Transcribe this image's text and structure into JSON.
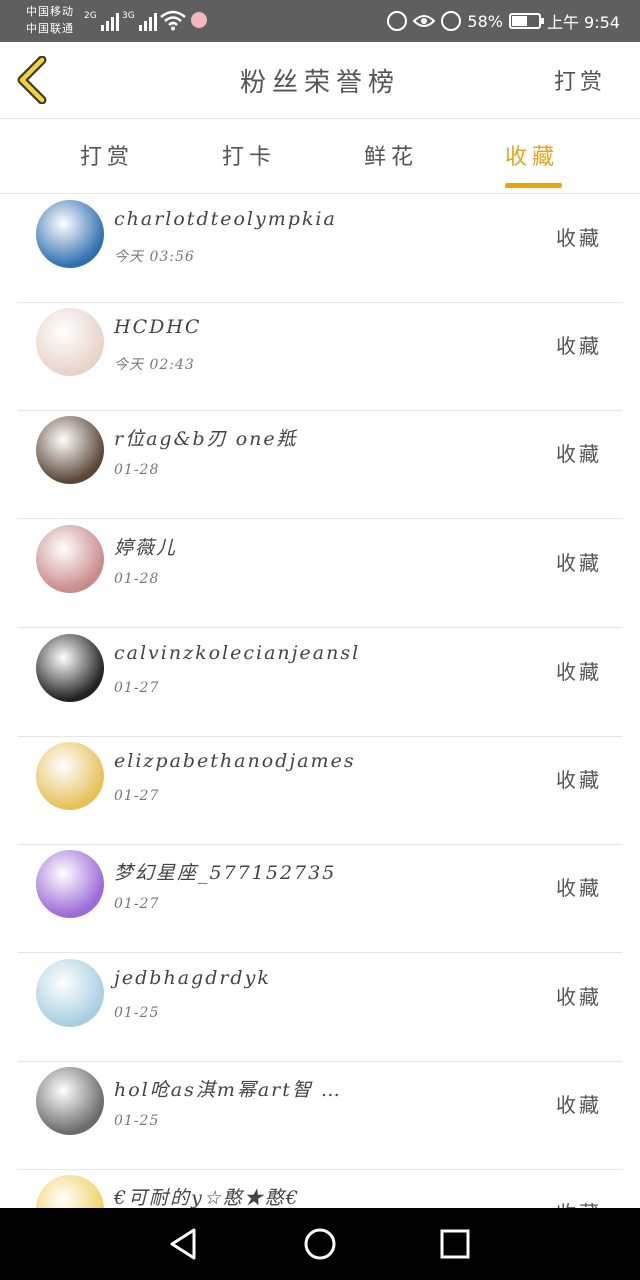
{
  "status_bar": {
    "carrier_1": "中国移动",
    "carrier_2": "中国联通",
    "net_1": "2G",
    "net_2": "3G",
    "battery": "58%",
    "time": "上午 9:54"
  },
  "header": {
    "title": "粉丝荣誉榜",
    "right_action": "打赏"
  },
  "tabs": [
    {
      "label": "打赏"
    },
    {
      "label": "打卡"
    },
    {
      "label": "鲜花"
    },
    {
      "label": "收藏",
      "active": true
    }
  ],
  "fans": [
    {
      "name": "charlotdteolympkia",
      "time": "今天 03:56",
      "action": "收藏",
      "avatar_color": "#2f6fb0"
    },
    {
      "name": "HCDHC",
      "time": "今天 02:43",
      "action": "收藏",
      "avatar_color": "#e8d3c8"
    },
    {
      "name": "r位ag&b刃 one羝",
      "time": "01-28",
      "action": "收藏",
      "avatar_color": "#5a4636"
    },
    {
      "name": "婷薇儿",
      "time": "01-28",
      "action": "收藏",
      "avatar_color": "#c98a8a"
    },
    {
      "name": "calvinzkolecianjeansl",
      "time": "01-27",
      "action": "收藏",
      "avatar_color": "#222222"
    },
    {
      "name": "elizpabethanodjames",
      "time": "01-27",
      "action": "收藏",
      "avatar_color": "#e6c15a"
    },
    {
      "name": "梦幻星座_577152735",
      "time": "01-27",
      "action": "收藏",
      "avatar_color": "#9a6ad6"
    },
    {
      "name": "jedbhagdrdyk",
      "time": "01-25",
      "action": "收藏",
      "avatar_color": "#a8cfe0"
    },
    {
      "name": "hol呛as淇m幂art智 …",
      "time": "01-25",
      "action": "收藏",
      "avatar_color": "#6b6b6b"
    },
    {
      "name": "€可耐的y☆憨★憨€",
      "time": "",
      "action": "收藏",
      "avatar_color": "#f0d060"
    }
  ],
  "colors": {
    "accent": "#e8a21f",
    "status_bar": "#5f5f5f",
    "nav_bar": "#000000"
  },
  "icons": {
    "back": "chevron-left-icon",
    "nav_back": "triangle-back-icon",
    "nav_home": "circle-home-icon",
    "nav_recent": "square-recent-icon"
  }
}
